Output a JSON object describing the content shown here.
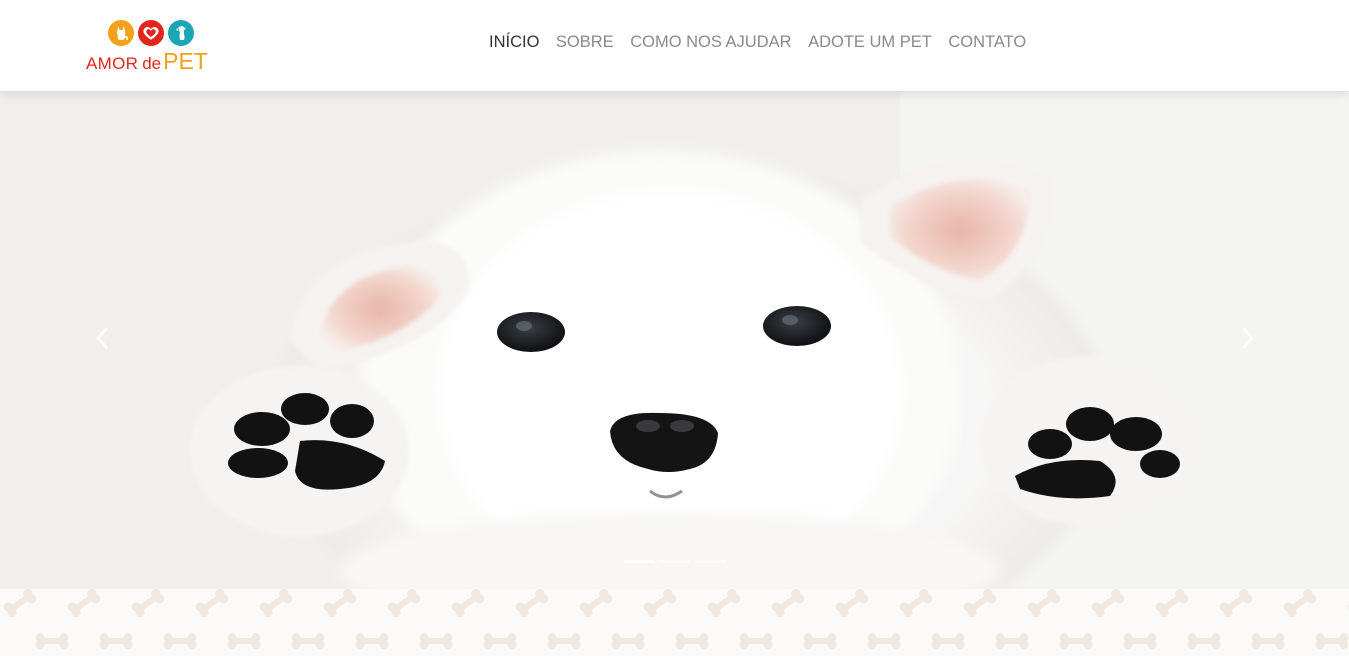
{
  "brand": {
    "name_part1": "AMOR",
    "name_part2": "de",
    "name_part3": "PET",
    "colors": {
      "red": "#e3261d",
      "orange": "#f5a01a",
      "teal": "#1ba6b6"
    },
    "icons": [
      "cat-icon",
      "heart-icon",
      "dog-icon"
    ]
  },
  "nav": {
    "items": [
      {
        "label": "INÍCIO",
        "active": true
      },
      {
        "label": "SOBRE",
        "active": false
      },
      {
        "label": "COMO NOS AJUDAR",
        "active": false
      },
      {
        "label": "ADOTE UM PET",
        "active": false
      },
      {
        "label": "CONTATO",
        "active": false
      }
    ]
  },
  "carousel": {
    "slide_image": "white-puppy-paws-up",
    "prev_icon": "chevron-left-icon",
    "next_icon": "chevron-right-icon",
    "slide_count": 3,
    "active_index": 0
  },
  "pattern": {
    "icon": "bone-icon",
    "color": "#f1e8e0"
  }
}
